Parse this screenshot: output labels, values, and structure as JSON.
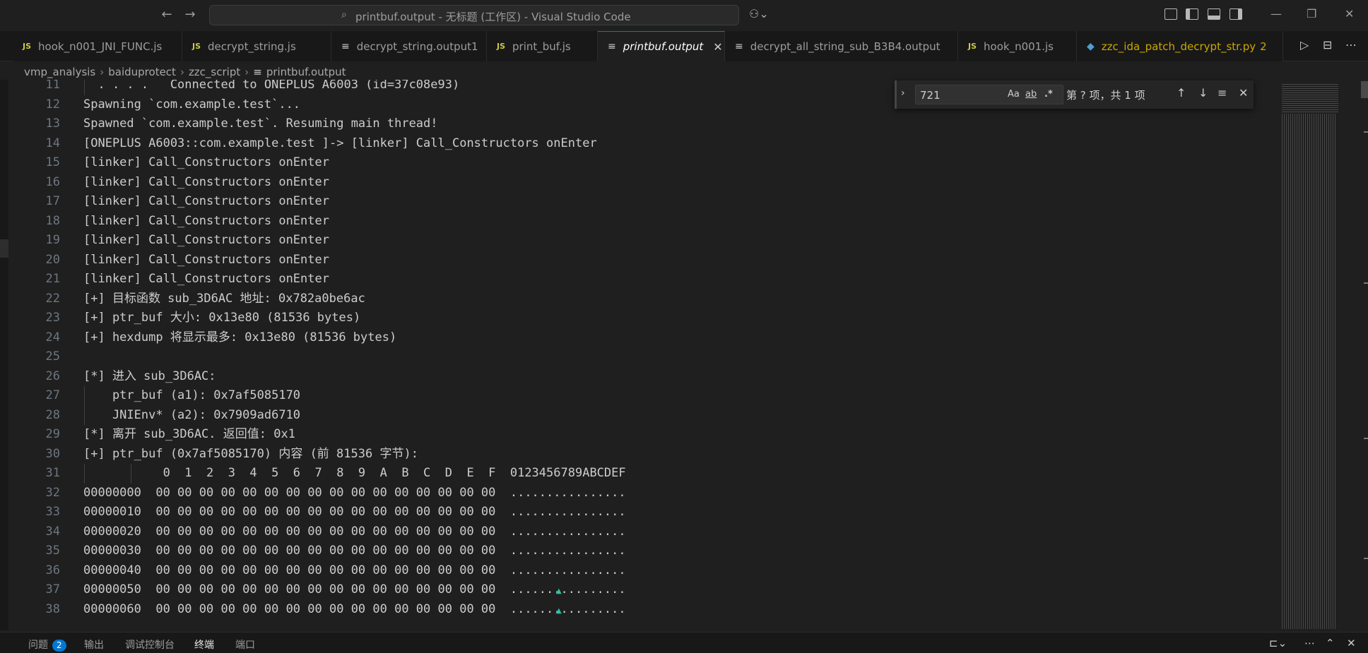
{
  "titlebar": {
    "back_icon": "arrow-left-icon",
    "forward_icon": "arrow-right-icon",
    "command_center_text": "printbuf.output - 无标题 (工作区) - Visual Studio Code",
    "copilot_icon": "copilot-icon"
  },
  "tabs": [
    {
      "label": "hook_n001_JNI_FUNC.js",
      "type": "js"
    },
    {
      "label": "decrypt_string.js",
      "type": "js"
    },
    {
      "label": "decrypt_string.output1",
      "type": "doc"
    },
    {
      "label": "print_buf.js",
      "type": "js"
    },
    {
      "label": "printbuf.output",
      "type": "doc",
      "active": true
    },
    {
      "label": "decrypt_all_string_sub_B3B4.output",
      "type": "doc"
    },
    {
      "label": "hook_n001.js",
      "type": "js"
    },
    {
      "label": "zzc_ida_patch_decrypt_str.py",
      "type": "py",
      "problems": "2"
    }
  ],
  "tab_icon_text": {
    "js": "JS",
    "doc": "≡",
    "py": "◆",
    "close": "✕"
  },
  "breadcrumb": [
    "vmp_analysis",
    "baiduprotect",
    "zzc_script",
    "printbuf.output"
  ],
  "find": {
    "value": "721",
    "match_case": "Aa",
    "whole_word": "ab",
    "regex": ".*",
    "result": "第 ? 项，共 1 项"
  },
  "editor": {
    "lines": [
      {
        "n": "11",
        "t": "  . . . .   Connected to ONEPLUS A6003 (id=37c08e93)"
      },
      {
        "n": "12",
        "t": "Spawning `com.example.test`..."
      },
      {
        "n": "13",
        "t": "Spawned `com.example.test`. Resuming main thread!"
      },
      {
        "n": "14",
        "t": "[ONEPLUS A6003::com.example.test ]-> [linker] Call_Constructors onEnter"
      },
      {
        "n": "15",
        "t": "[linker] Call_Constructors onEnter"
      },
      {
        "n": "16",
        "t": "[linker] Call_Constructors onEnter"
      },
      {
        "n": "17",
        "t": "[linker] Call_Constructors onEnter"
      },
      {
        "n": "18",
        "t": "[linker] Call_Constructors onEnter"
      },
      {
        "n": "19",
        "t": "[linker] Call_Constructors onEnter"
      },
      {
        "n": "20",
        "t": "[linker] Call_Constructors onEnter"
      },
      {
        "n": "21",
        "t": "[linker] Call_Constructors onEnter"
      },
      {
        "n": "22",
        "t": "[+] 目标函数 sub_3D6AC 地址: 0x782a0be6ac"
      },
      {
        "n": "23",
        "t": "[+] ptr_buf 大小: 0x13e80 (81536 bytes)"
      },
      {
        "n": "24",
        "t": "[+] hexdump 将显示最多: 0x13e80 (81536 bytes)"
      },
      {
        "n": "25",
        "t": ""
      },
      {
        "n": "26",
        "t": "[*] 进入 sub_3D6AC:"
      },
      {
        "n": "27",
        "t": "    ptr_buf (a1): 0x7af5085170"
      },
      {
        "n": "28",
        "t": "    JNIEnv* (a2): 0x7909ad6710"
      },
      {
        "n": "29",
        "t": "[*] 离开 sub_3D6AC. 返回值: 0x1"
      },
      {
        "n": "30",
        "t": "[+] ptr_buf (0x7af5085170) 内容 (前 81536 字节):"
      },
      {
        "n": "31",
        "t": "           0  1  2  3  4  5  6  7  8  9  A  B  C  D  E  F  0123456789ABCDEF"
      },
      {
        "n": "32",
        "t": "00000000  00 00 00 00 00 00 00 00 00 00 00 00 00 00 00 00  ................"
      },
      {
        "n": "33",
        "t": "00000010  00 00 00 00 00 00 00 00 00 00 00 00 00 00 00 00  ................"
      },
      {
        "n": "34",
        "t": "00000020  00 00 00 00 00 00 00 00 00 00 00 00 00 00 00 00  ................"
      },
      {
        "n": "35",
        "t": "00000030  00 00 00 00 00 00 00 00 00 00 00 00 00 00 00 00  ................"
      },
      {
        "n": "36",
        "t": "00000040  00 00 00 00 00 00 00 00 00 00 00 00 00 00 00 00  ................"
      },
      {
        "n": "37",
        "t": "00000050  00 00 00 00 00 00 00 00 00 00 00 00 00 00 00 00  ................"
      },
      {
        "n": "38",
        "t": "00000060  00 00 00 00 00 00 00 00 00 00 00 00 00 00 00 00  ................"
      }
    ]
  },
  "panel": {
    "tabs": [
      {
        "label": "问题",
        "badge": "2"
      },
      {
        "label": "输出"
      },
      {
        "label": "调试控制台"
      },
      {
        "label": "终端",
        "active": true
      },
      {
        "label": "端口"
      }
    ]
  },
  "colors": {
    "accent": "#0078d4",
    "js_icon": "#cbcb41",
    "warning": "#cca700"
  }
}
